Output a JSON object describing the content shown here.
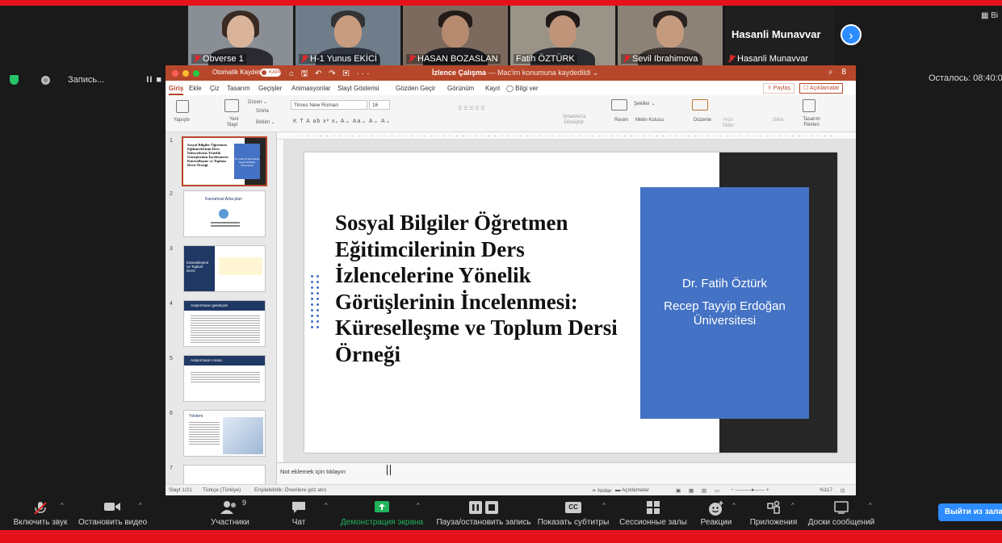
{
  "participants": [
    {
      "name": "Obverse 1",
      "muted": true
    },
    {
      "name": "H-1 Yunus EKİCİ",
      "muted": true
    },
    {
      "name": "HASAN BOZASLAN",
      "muted": true
    },
    {
      "name": "Fatih ÖZTÜRK",
      "muted": false
    },
    {
      "name": "Sevil Ibrahimova",
      "muted": true
    }
  ],
  "name_tile": {
    "display_name": "Hasanli Munavvar",
    "label": "Hasanli Munavvar"
  },
  "top_right_label": "Bi",
  "recording": {
    "label": "Запись...",
    "pause_glyph": "II ■"
  },
  "remaining": "Осталось: 08:40:0",
  "powerpoint": {
    "autosave_label": "Otomatik Kaydet",
    "autosave_state": "KAPALI",
    "quick_access": "⌂ 🖫 ↶ ↷ ▣ ···",
    "doc_title": "İzlence Çalışma",
    "doc_status": "— Mac'im konumuna kaydedildi ⌄",
    "title_right": "⌕ 8",
    "menu": [
      "Giriş",
      "Ekle",
      "Çiz",
      "Tasarım",
      "Geçişler",
      "Animasyonlar",
      "Slayt Gösterisi",
      "Gözden Geçir",
      "Görünüm",
      "Kayıt",
      "◯ Bilgi ver"
    ],
    "share": "⇪ Paylaş",
    "comments": "☐ Açıklamalar",
    "ribbon": {
      "paste": "Yapıştır",
      "new_slide_1": "Yeni",
      "new_slide_2": "Slayt",
      "layout": "Düzen ⌄",
      "reset": "Sıfırla",
      "section": "Bölüm ⌄",
      "font": "Times New Roman",
      "size": "16",
      "font_row2": "K  T  A  ab  x²  x₂  A⌄  Aa⌄    A⌄  A⌄",
      "smartart": "SmartArt'a Dönüştür",
      "picture": "Resim",
      "shapes": "Şekiller ⌄",
      "textbox": "Metin Kutusu",
      "arrange": "Düzenle",
      "quick_styles": "Hızlı Stiller",
      "designer": "Tasarım Fikirleri",
      "dictate": "Dikte"
    },
    "thumb_numbers": [
      "1",
      "2",
      "3",
      "4",
      "5",
      "6",
      "7"
    ],
    "thumbs": {
      "t1_title": "Sosyal Bilgiler Öğretmen Eğitimcilerinin Ders İzlencelerine Yönelik Görüşlerinin İncelenmesi: Küreselleşme ve Toplum Dersi Örneği",
      "t1_box": "Dr. Fatih Öztürk Recep Tayyip Erdoğan Üniversitesi",
      "t2_title": "Kavramsal Arka plan",
      "t3_title": "Küreselleşme ve Toplum Dersi",
      "t4_title": "Araştırmanın gerekçesi",
      "t5_title": "Araştırmanın Amacı",
      "t6_title": "Yöntem"
    },
    "slide": {
      "title": "Sosyal Bilgiler Öğretmen Eğitimcilerinin Ders İzlencelerine Yönelik Görüşlerinin İncelenmesi: Küreselleşme ve Toplum Dersi Örneği",
      "author": "Dr. Fatih Öztürk",
      "affiliation_1": "Recep Tayyip Erdoğan",
      "affiliation_2": "Üniversitesi"
    },
    "notes_placeholder": "Not eklemek için tıklayın",
    "status": {
      "slide": "Slayt 1/21",
      "language": "Türkçe (Türkiye)",
      "accessibility": "Erişilebilirlik: Önerilere göz atın",
      "notes": "≐ Notlar",
      "comments": "▬ Açıklamalar",
      "zoom": "%117"
    }
  },
  "toolbar": {
    "mute": "Включить звук",
    "video": "Остановить видео",
    "participants": "Участники",
    "participants_count": "9",
    "chat": "Чат",
    "share": "Демонстрация экрана",
    "record": "Пауза/остановить запись",
    "captions": "Показать субтитры",
    "captions_glyph": "CC",
    "breakout": "Сессионные залы",
    "reactions": "Реакции",
    "apps": "Приложения",
    "whiteboard": "Доски сообщений",
    "exit": "Выйти из зала"
  },
  "colors": {
    "ppt_red": "#b7472a",
    "zoom_blue": "#2d8cff",
    "share_green": "#20b45a",
    "slide_blue": "#4472c4",
    "frame_red": "#e5121c"
  }
}
